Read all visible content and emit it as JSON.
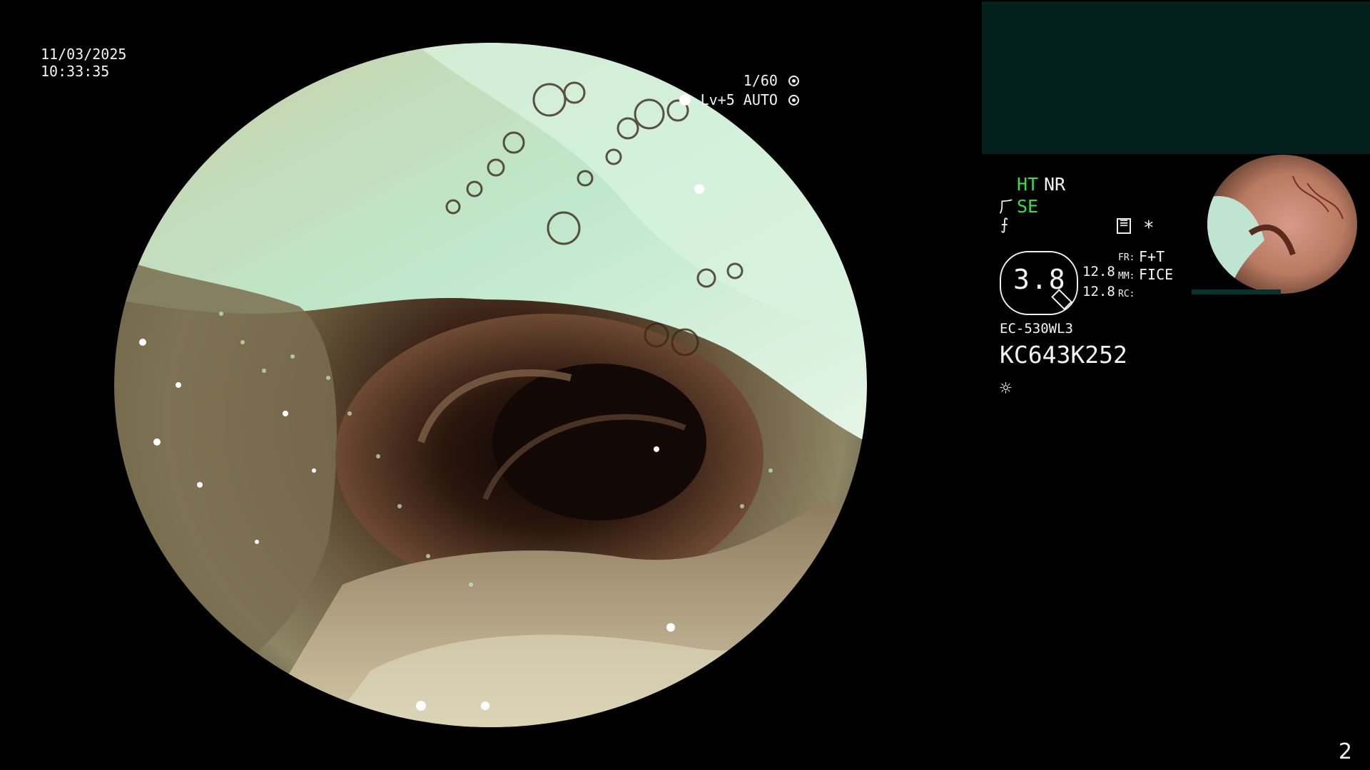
{
  "overlay": {
    "date": "11/03/2025",
    "time": "10:33:35",
    "shutter": "1/60",
    "level_mode": "Lv+5 AUTO"
  },
  "processor_panel": {
    "ht": "HT",
    "nr": "NR",
    "se": "SE",
    "fr_label": "FR:",
    "fr_value": "F+T",
    "mm_label": "MM:",
    "mm_value": "FICE",
    "rc_label": "RC:",
    "zoom": "3.8",
    "zoom_upper": "12.8",
    "zoom_lower": "12.8",
    "scope_model": "EC-530WL3",
    "serial": "KC643K252",
    "asterisk": "*"
  },
  "page_number": "2",
  "colors": {
    "background": "#000000",
    "teal_panel": "#03201d",
    "status_green": "#33e04a",
    "text": "#f4f4f4"
  },
  "icons": [
    "iris-icon",
    "auto-iris-icon",
    "scope-hand-icon",
    "freeze-icon",
    "memo-icon",
    "light-source-icon"
  ]
}
